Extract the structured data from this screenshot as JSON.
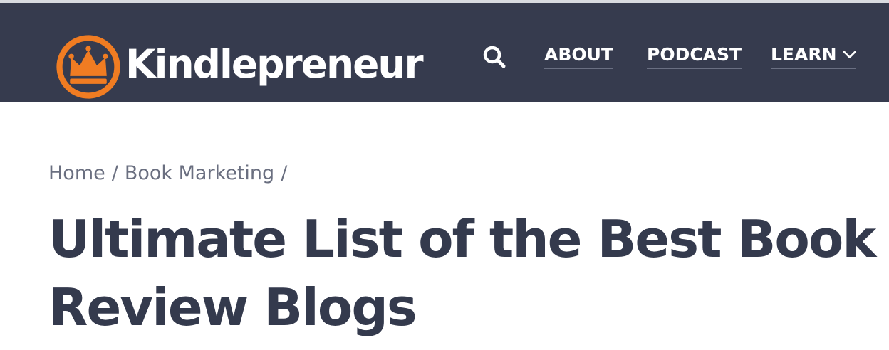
{
  "header": {
    "logo_text": "Kindlepreneur",
    "search_icon": "search-icon",
    "nav": [
      {
        "label": "ABOUT"
      },
      {
        "label": "PODCAST"
      },
      {
        "label": "LEARN"
      }
    ],
    "learn_chevron_icon": "chevron-down-icon"
  },
  "breadcrumb": {
    "home": "Home",
    "sep1": "/",
    "section": "Book Marketing",
    "sep2": "/"
  },
  "article": {
    "title": "Ultimate List of the Best Book Review Blogs"
  },
  "colors": {
    "header_bg": "#363b4e",
    "accent_orange": "#f07c22",
    "title_text": "#343a4d",
    "breadcrumb_text": "#6a6f80"
  }
}
